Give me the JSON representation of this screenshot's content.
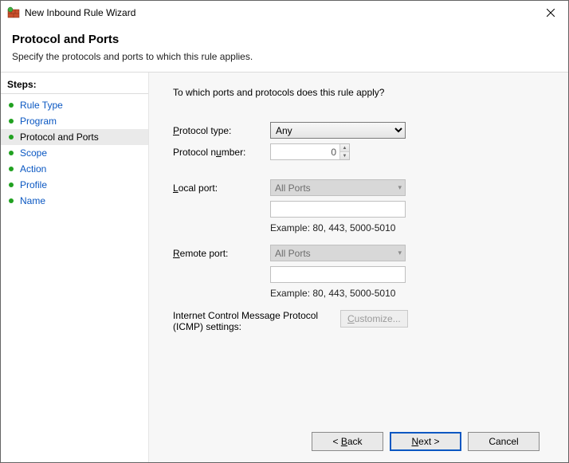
{
  "window": {
    "title": "New Inbound Rule Wizard"
  },
  "header": {
    "title": "Protocol and Ports",
    "subtitle": "Specify the protocols and ports to which this rule applies."
  },
  "sidebar": {
    "title": "Steps:",
    "items": [
      {
        "label": "Rule Type",
        "current": false
      },
      {
        "label": "Program",
        "current": false
      },
      {
        "label": "Protocol and Ports",
        "current": true
      },
      {
        "label": "Scope",
        "current": false
      },
      {
        "label": "Action",
        "current": false
      },
      {
        "label": "Profile",
        "current": false
      },
      {
        "label": "Name",
        "current": false
      }
    ]
  },
  "content": {
    "question": "To which ports and protocols does this rule apply?",
    "protocol_type_label": "Protocol type:",
    "protocol_type_value": "Any",
    "protocol_number_label": "Protocol number:",
    "protocol_number_value": "0",
    "local_port_label": "Local port:",
    "local_port_value": "All Ports",
    "local_port_input": "",
    "local_port_example": "Example: 80, 443, 5000-5010",
    "remote_port_label": "Remote port:",
    "remote_port_value": "All Ports",
    "remote_port_input": "",
    "remote_port_example": "Example: 80, 443, 5000-5010",
    "icmp_label": "Internet Control Message Protocol (ICMP) settings:",
    "customize_label": "Customize..."
  },
  "footer": {
    "back": "< Back",
    "next": "Next >",
    "cancel": "Cancel"
  }
}
